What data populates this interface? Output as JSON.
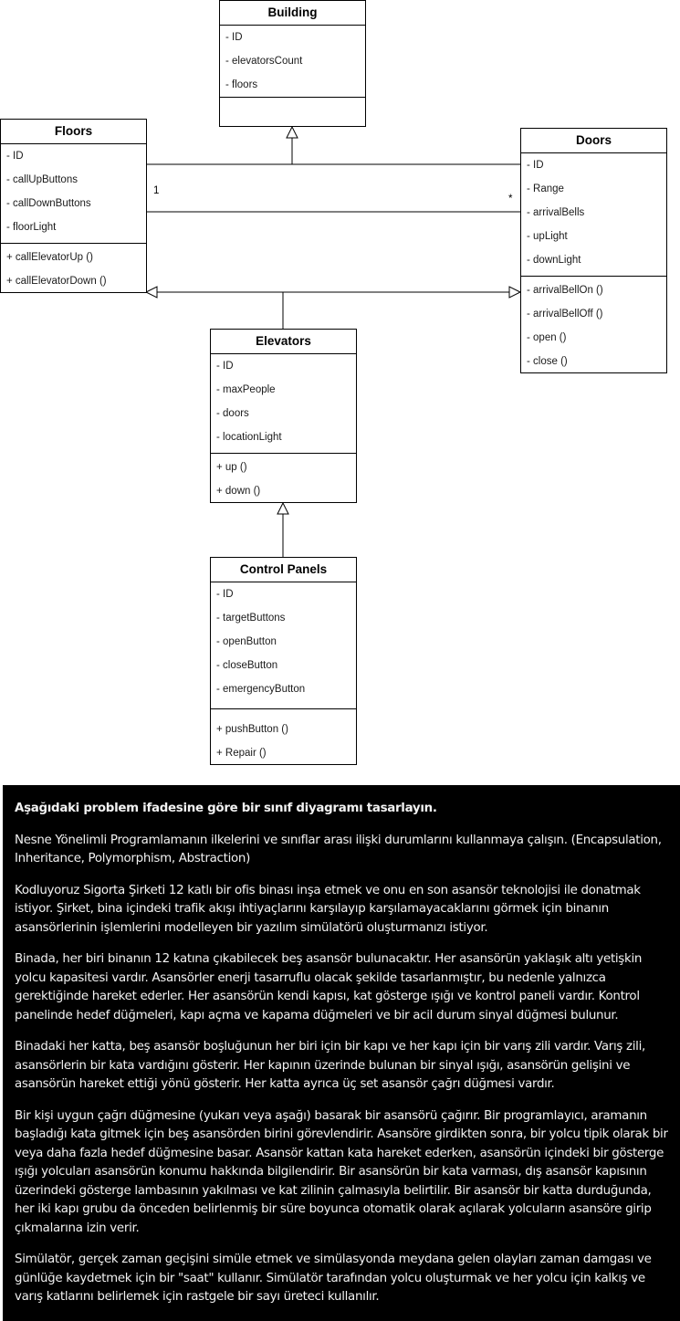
{
  "diagram": {
    "classes": {
      "building": {
        "name": "Building",
        "attributes": [
          "- ID",
          "- elevatorsCount",
          "- floors"
        ],
        "methods": []
      },
      "floors": {
        "name": "Floors",
        "attributes": [
          "- ID",
          "- callUpButtons",
          "- callDownButtons",
          "- floorLight"
        ],
        "methods": [
          "+ callElevatorUp ()",
          "+ callElevatorDown ()"
        ]
      },
      "doors": {
        "name": "Doors",
        "attributes": [
          "- ID",
          "- Range",
          "- arrivalBells",
          "- upLight",
          "- downLight"
        ],
        "methods": [
          "- arrivalBellOn ()",
          "- arrivalBellOff ()",
          "- open ()",
          "- close ()"
        ]
      },
      "elevators": {
        "name": "Elevators",
        "attributes": [
          "- ID",
          "- maxPeople",
          "- doors",
          "- locationLight"
        ],
        "methods": [
          "+ up ()",
          "+ down ()"
        ]
      },
      "control_panels": {
        "name": "Control Panels",
        "attributes": [
          "- ID",
          "- targetButtons",
          "- openButton",
          "- closeButton",
          "- emergencyButton"
        ],
        "methods": [
          "+ pushButton ()",
          "+ Repair ()"
        ]
      }
    },
    "multiplicity": {
      "floors_side": "1",
      "doors_side": "*"
    }
  },
  "problem": {
    "heading": "Aşağıdaki problem ifadesine göre bir sınıf diyagramı tasarlayın.",
    "paragraphs": [
      "Nesne Yönelimli Programlamanın ilkelerini ve sınıflar arası ilişki durumlarını kullanmaya çalışın. (Encapsulation, Inheritance, Polymorphism, Abstraction)",
      "Kodluyoruz Sigorta Şirketi 12 katlı bir ofis binası inşa etmek ve onu en son asansör teknolojisi ile donatmak istiyor. Şirket, bina içindeki trafik akışı ihtiyaçlarını karşılayıp karşılamayacaklarını görmek için binanın asansörlerinin işlemlerini modelleyen bir yazılım simülatörü oluşturmanızı istiyor.",
      "Binada, her biri binanın 12 katına çıkabilecek beş asansör bulunacaktır. Her asansörün yaklaşık altı yetişkin yolcu kapasitesi vardır. Asansörler enerji tasarruflu olacak şekilde tasarlanmıştır, bu nedenle yalnızca gerektiğinde hareket ederler. Her asansörün kendi kapısı, kat gösterge ışığı ve kontrol paneli vardır. Kontrol panelinde hedef düğmeleri, kapı açma ve kapama düğmeleri ve bir acil durum sinyal düğmesi bulunur.",
      "Binadaki her katta, beş asansör boşluğunun her biri için bir kapı ve her kapı için bir varış zili vardır. Varış zili, asansörlerin bir kata vardığını gösterir. Her kapının üzerinde bulunan bir sinyal ışığı, asansörün gelişini ve asansörün hareket ettiği yönü gösterir. Her katta ayrıca üç set asansör çağrı düğmesi vardır.",
      "Bir kişi uygun çağrı düğmesine (yukarı veya aşağı) basarak bir asansörü çağırır. Bir programlayıcı, aramanın başladığı kata gitmek için beş asansörden birini görevlendirir. Asansöre girdikten sonra, bir yolcu tipik olarak bir veya daha fazla hedef düğmesine basar. Asansör kattan kata hareket ederken, asansörün içindeki bir gösterge ışığı yolcuları asansörün konumu hakkında bilgilendirir. Bir asansörün bir kata varması, dış asansör kapısının üzerindeki gösterge lambasının yakılması ve kat zilinin çalmasıyla belirtilir. Bir asansör bir katta durduğunda, her iki kapı grubu da önceden belirlenmiş bir süre boyunca otomatik olarak açılarak yolcuların asansöre girip çıkmalarına izin verir.",
      "Simülatör, gerçek zaman geçişini simüle etmek ve simülasyonda meydana gelen olayları zaman damgası ve günlüğe kaydetmek için bir \"saat\" kullanır. Simülatör tarafından yolcu oluşturmak ve her yolcu için kalkış ve varış katlarını belirlemek için rastgele bir sayı üreteci kullanılır."
    ]
  }
}
